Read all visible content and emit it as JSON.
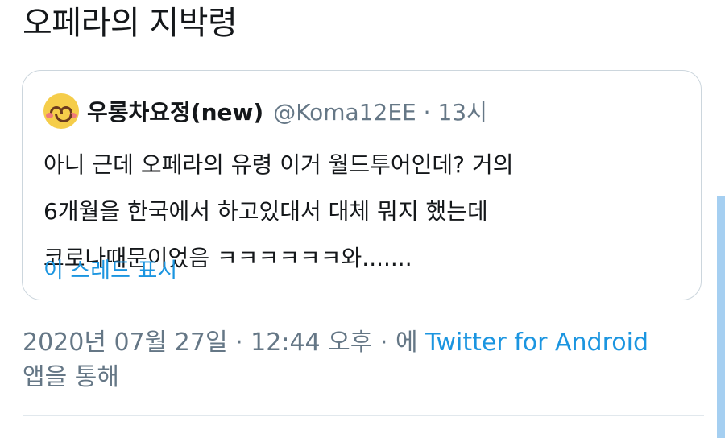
{
  "tweet": {
    "text": "오페라의 지박령",
    "timestamp": "2020년 07월 27일 · 12:44 오후 · 에 ",
    "source": "Twitter for Android",
    "source_suffix": "앱을 통해"
  },
  "quote": {
    "avatar_icon": "smiling-face-with-blush-emoji",
    "display_name": "우롱차요정(new)",
    "handle": "@Koma12EE",
    "separator": "·",
    "time_ago": "13시",
    "lines": [
      "아니 근데 오페라의 유령 이거 월드투어인데? 거의",
      "6개월을 한국에서 하고있대서 대체 뭐지 했는데",
      "코로나때문이었음 ㅋㅋㅋㅋㅋㅋ와......."
    ],
    "show_thread": "이 스레드 표시"
  },
  "colors": {
    "link": "#1b95e0",
    "secondary_text": "#657786",
    "border": "#ccd6dd"
  }
}
